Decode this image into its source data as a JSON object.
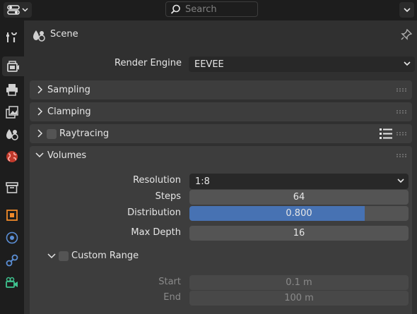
{
  "header": {
    "search_placeholder": "Search"
  },
  "context": {
    "title": "Scene"
  },
  "render_engine": {
    "label": "Render Engine",
    "value": "EEVEE"
  },
  "panels": {
    "sampling": "Sampling",
    "clamping": "Clamping",
    "raytracing": "Raytracing",
    "volumes": "Volumes"
  },
  "volumes": {
    "resolution_label": "Resolution",
    "resolution_value": "1:8",
    "steps_label": "Steps",
    "steps_value": "64",
    "distribution_label": "Distribution",
    "distribution_value": "0.800",
    "distribution_fraction": 0.8,
    "max_depth_label": "Max Depth",
    "max_depth_value": "16",
    "custom_range_label": "Custom Range",
    "start_label": "Start",
    "start_value": "0.1 m",
    "end_label": "End",
    "end_value": "100 m"
  },
  "colors": {
    "accent": "#4772b3",
    "panel": "#3d3d3d",
    "background": "#303030"
  }
}
